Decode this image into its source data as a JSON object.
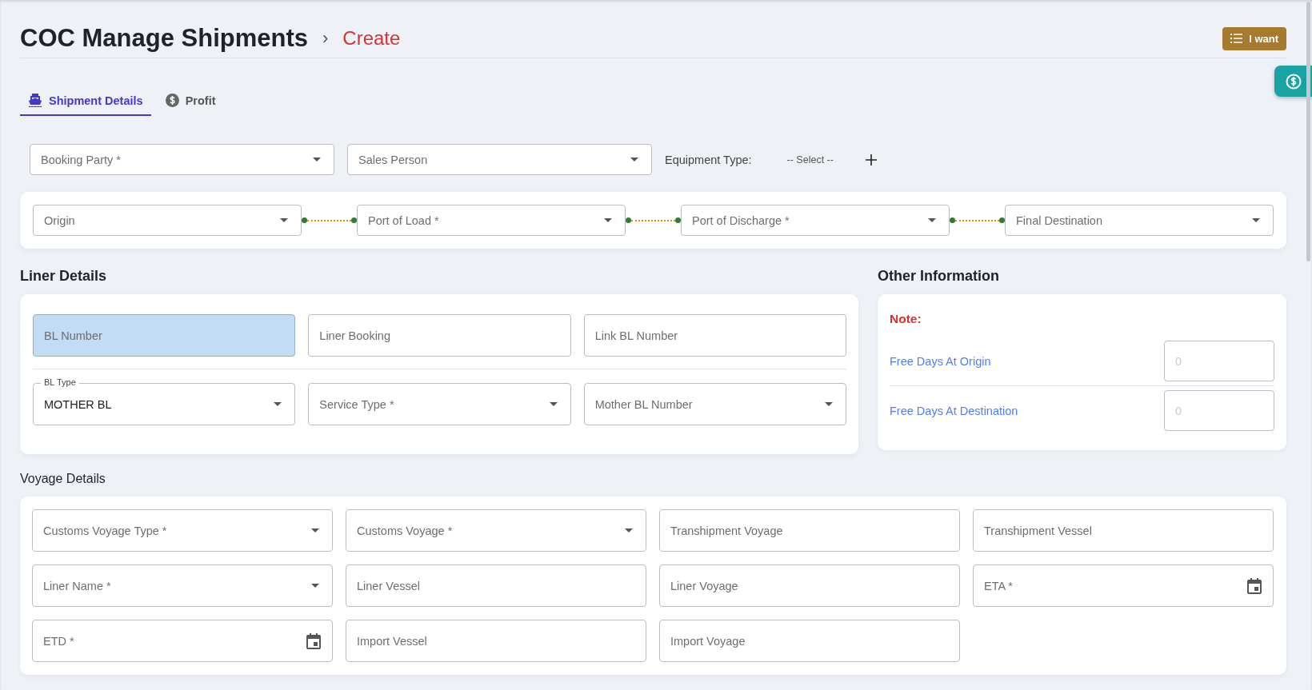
{
  "header": {
    "title": "COC Manage Shipments",
    "separator": "›",
    "current": "Create",
    "action_button": "I want"
  },
  "tabs": [
    {
      "label": "Shipment Details",
      "selected": true
    },
    {
      "label": "Profit",
      "selected": false
    }
  ],
  "top_fields": [
    {
      "kind": "select",
      "placeholder": "Booking Party *"
    },
    {
      "kind": "select",
      "placeholder": "Sales Person"
    }
  ],
  "equipment": {
    "label": "Equipment Type:",
    "placeholder": "-- Select --"
  },
  "route": [
    {
      "kind": "select",
      "placeholder": "Origin"
    },
    {
      "kind": "select",
      "placeholder": "Port of Load *"
    },
    {
      "kind": "select",
      "placeholder": "Port of Discharge *"
    },
    {
      "kind": "select",
      "placeholder": "Final Destination"
    }
  ],
  "liner_details": {
    "title": "Liner Details",
    "rows": [
      {
        "fields": [
          {
            "kind": "text",
            "placeholder": "BL Number",
            "highlighted": true
          },
          {
            "kind": "text",
            "placeholder": "Liner Booking",
            "highlighted": false
          },
          {
            "kind": "text",
            "placeholder": "Link BL Number",
            "highlighted": false
          }
        ]
      },
      {
        "fields": [
          {
            "kind": "select",
            "label": "BL Type",
            "value": "MOTHER BL",
            "highlighted": false
          },
          {
            "kind": "select",
            "placeholder": "Service Type *",
            "highlighted": false
          },
          {
            "kind": "select",
            "placeholder": "Mother BL Number",
            "highlighted": false
          }
        ]
      }
    ]
  },
  "other_information": {
    "title": "Other Information",
    "note": "Note:",
    "items": [
      {
        "label": "Free Days At Origin",
        "placeholder": "0"
      },
      {
        "label": "Free Days At Destination",
        "placeholder": "0"
      }
    ]
  },
  "voyage_details": {
    "title": "Voyage Details",
    "fields": [
      {
        "kind": "select",
        "placeholder": "Customs Voyage Type *"
      },
      {
        "kind": "select",
        "placeholder": "Customs Voyage *"
      },
      {
        "kind": "text",
        "placeholder": "Transhipment Voyage"
      },
      {
        "kind": "text",
        "placeholder": "Transhipment Vessel"
      },
      {
        "kind": "select",
        "placeholder": "Liner Name *"
      },
      {
        "kind": "text",
        "placeholder": "Liner Vessel"
      },
      {
        "kind": "text",
        "placeholder": "Liner Voyage"
      },
      {
        "kind": "date",
        "placeholder": "ETA *"
      },
      {
        "kind": "date",
        "placeholder": "ETD *"
      },
      {
        "kind": "text",
        "placeholder": "Import Vessel"
      },
      {
        "kind": "text",
        "placeholder": "Import Voyage"
      }
    ]
  }
}
